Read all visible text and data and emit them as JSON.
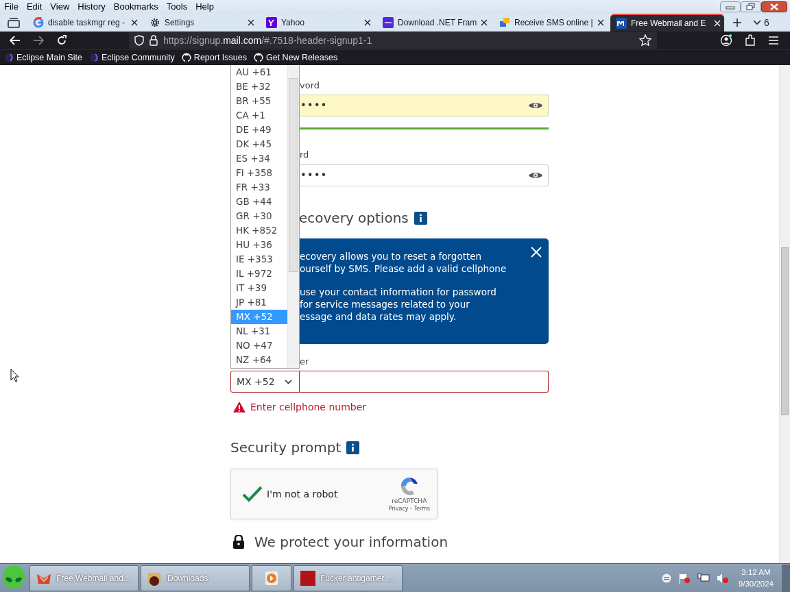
{
  "menu_bar": [
    "File",
    "Edit",
    "View",
    "History",
    "Bookmarks",
    "Tools",
    "Help"
  ],
  "tabs": [
    {
      "title": "disable taskmgr reg -",
      "kind": "google",
      "selected": false
    },
    {
      "title": "Settings",
      "kind": "settings",
      "selected": false
    },
    {
      "title": "Yahoo",
      "kind": "yahoo",
      "selected": false
    },
    {
      "title": "Download .NET Fram",
      "kind": "dotnet",
      "selected": false
    },
    {
      "title": "Receive SMS online |",
      "kind": "sms",
      "selected": false
    },
    {
      "title": "Free Webmail and E",
      "kind": "mail",
      "selected": true
    }
  ],
  "tab_count": "6",
  "url_parts": [
    "https://signup.",
    "mail.com",
    "/#.7518-header-signup1-1"
  ],
  "bookmarks": [
    {
      "label": "Eclipse Main Site",
      "kind": "eclipse"
    },
    {
      "label": "Eclipse Community",
      "kind": "eclipse"
    },
    {
      "label": "Report Issues",
      "kind": "github"
    },
    {
      "label": "Get New Releases",
      "kind": "github"
    }
  ],
  "country_dropdown": {
    "options": [
      {
        "label": "AU +61",
        "selected": false
      },
      {
        "label": "BE +32",
        "selected": false
      },
      {
        "label": "BR +55",
        "selected": false
      },
      {
        "label": "CA +1",
        "selected": false
      },
      {
        "label": "DE +49",
        "selected": false
      },
      {
        "label": "DK +45",
        "selected": false
      },
      {
        "label": "ES +34",
        "selected": false
      },
      {
        "label": "FI +358",
        "selected": false
      },
      {
        "label": "FR +33",
        "selected": false
      },
      {
        "label": "GB +44",
        "selected": false
      },
      {
        "label": "GR +30",
        "selected": false
      },
      {
        "label": "HK +852",
        "selected": false
      },
      {
        "label": "HU +36",
        "selected": false
      },
      {
        "label": "IE +353",
        "selected": false
      },
      {
        "label": "IL +972",
        "selected": false
      },
      {
        "label": "IT +39",
        "selected": false
      },
      {
        "label": "JP +81",
        "selected": false
      },
      {
        "label": "MX +52",
        "selected": true
      },
      {
        "label": "NL +31",
        "selected": false
      },
      {
        "label": "NO +47",
        "selected": false
      },
      {
        "label": "NZ +64",
        "selected": false
      }
    ]
  },
  "form": {
    "password": {
      "label": "vord",
      "value": "••••",
      "autofilled": true
    },
    "password_strength": {
      "level": 1
    },
    "repeat_password": {
      "label": "rd",
      "value": "••••",
      "autofilled": false
    },
    "recovery_heading": "ecovery options",
    "info_paragraphs": [
      [
        "ecovery allows you to reset a forgotten",
        "ourself by SMS. Please add a valid cellphone"
      ],
      [
        "use your contact information for password",
        "for service messages related to your",
        "essage and data rates may apply."
      ]
    ],
    "phone": {
      "label": "er",
      "code": "MX +52",
      "invalid": true,
      "error": "Enter cellphone number"
    },
    "security_heading": "Security prompt",
    "captcha": {
      "label": "I'm not a robot",
      "checked": true,
      "brand": "reCAPTCHA",
      "links": "Privacy - Terms"
    },
    "protect_heading": "We protect your information"
  },
  "taskbar": {
    "items": [
      {
        "label": "Free Webmail and...",
        "kind": "browser"
      },
      {
        "label": "Downloads",
        "kind": "folder"
      },
      {
        "kind": "media"
      },
      {
        "label": "Fucker antigamer ...",
        "kind": "app"
      }
    ],
    "clock": {
      "time": "3:12 AM",
      "date": "9/30/2024"
    }
  }
}
